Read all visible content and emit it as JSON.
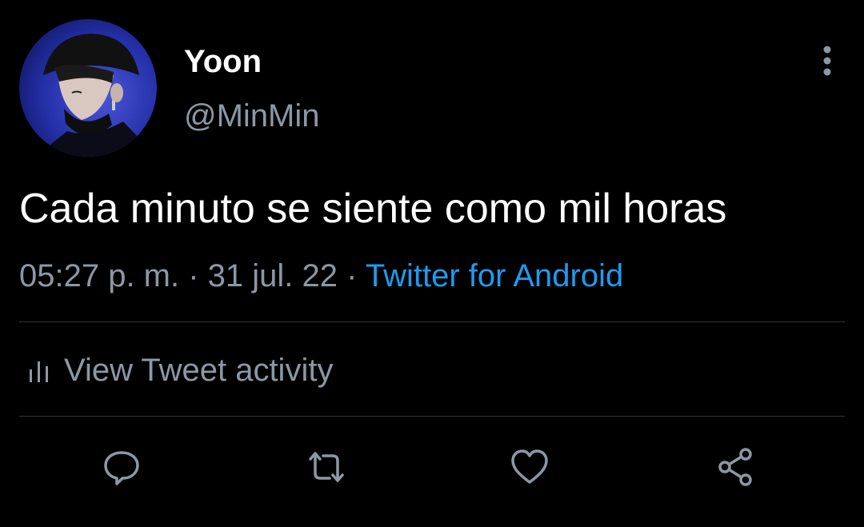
{
  "tweet": {
    "author": {
      "display_name": "Yoon",
      "handle": "@MinMin"
    },
    "text": "Cada minuto se siente como mil horas",
    "time": "05:27 p. m.",
    "date": "31 jul. 22",
    "source": "Twitter for Android",
    "separator": " · "
  },
  "activity": {
    "label": "View Tweet activity",
    "icon": "bar-chart-icon"
  },
  "actions": [
    {
      "name": "reply",
      "icon": "reply-icon"
    },
    {
      "name": "retweet",
      "icon": "retweet-icon"
    },
    {
      "name": "like",
      "icon": "heart-icon"
    },
    {
      "name": "share",
      "icon": "share-icon"
    }
  ],
  "colors": {
    "background": "#000000",
    "primary_text": "#ffffff",
    "secondary_text": "#8b98a5",
    "link": "#1d9bf0",
    "divider": "#2f3336"
  }
}
